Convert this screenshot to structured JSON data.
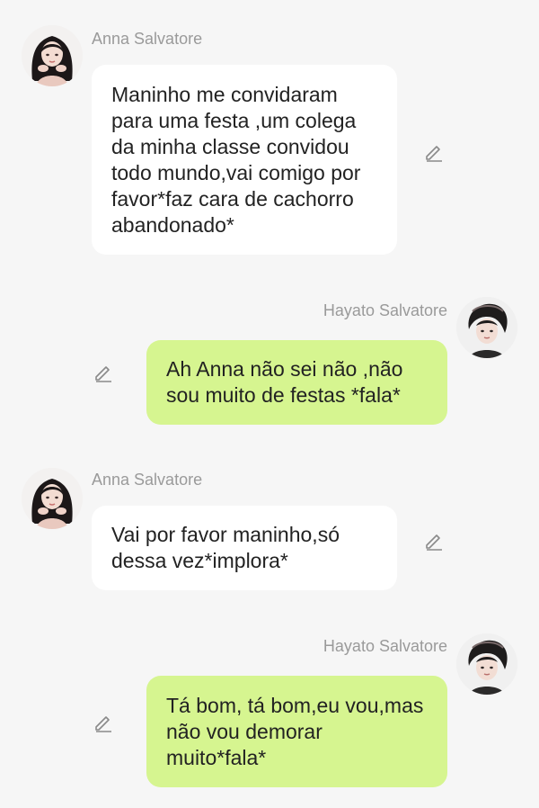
{
  "messages": [
    {
      "sender": "Anna Salvatore",
      "side": "left",
      "avatar_icon": "anna-avatar-icon",
      "text": "Maninho me convidaram para uma festa ,um colega da minha classe convidou todo mundo,vai comigo por favor*faz cara de cachorro abandonado*"
    },
    {
      "sender": "Hayato Salvatore",
      "side": "right",
      "avatar_icon": "hayato-avatar-icon",
      "text": "Ah Anna não sei não ,não sou muito de festas *fala*"
    },
    {
      "sender": "Anna Salvatore",
      "side": "left",
      "avatar_icon": "anna-avatar-icon",
      "text": "Vai por favor maninho,só dessa vez*implora*"
    },
    {
      "sender": "Hayato Salvatore",
      "side": "right",
      "avatar_icon": "hayato-avatar-icon",
      "text": "Tá bom, tá bom,eu vou,mas não vou demorar muito*fala*"
    }
  ],
  "colors": {
    "background": "#f6f6f6",
    "left_bubble": "#ffffff",
    "right_bubble": "#d6f590",
    "sender_name": "#9a9a9a",
    "message_text": "#222222",
    "edit_icon": "#8a8a8a"
  },
  "icons": {
    "edit": "pencil-edit-icon"
  }
}
